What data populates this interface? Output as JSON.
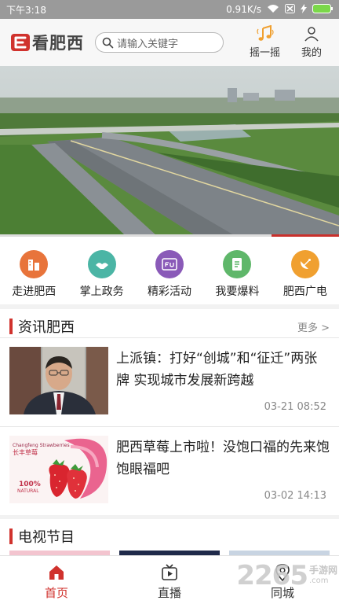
{
  "status_bar": {
    "time": "下午3:18",
    "speed": "0.91K/s"
  },
  "header": {
    "logo_text": "看肥西",
    "search_placeholder": "请输入关键字",
    "shake_label": "摇一摇",
    "mine_label": "我的"
  },
  "banner": {
    "progress": 0.2
  },
  "quick_nav": [
    {
      "label": "走进肥西",
      "color": "#e8743b"
    },
    {
      "label": "掌上政务",
      "color": "#4bb5a5"
    },
    {
      "label": "精彩活动",
      "color": "#8a5ab8"
    },
    {
      "label": "我要爆料",
      "color": "#5fb76a"
    },
    {
      "label": "肥西广电",
      "color": "#f0a030"
    }
  ],
  "news_section": {
    "title": "资讯肥西",
    "more": "更多 >",
    "items": [
      {
        "title": "上派镇：打好“创城”和“征迁”两张牌 实现城市发展新跨越",
        "time": "03-21 08:52"
      },
      {
        "title": "肥西草莓上市啦！没饱口福的先来饱饱眼福吧",
        "time": "03-02 14:13"
      }
    ]
  },
  "tv_section": {
    "title": "电视节目"
  },
  "tabbar": [
    {
      "label": "首页",
      "active": true
    },
    {
      "label": "直播",
      "active": false
    },
    {
      "label": "同城",
      "active": false
    }
  ],
  "watermark": {
    "number": "2265",
    "line1": "手游网",
    "line2": ".com"
  },
  "colors": {
    "accent": "#d0322d"
  }
}
